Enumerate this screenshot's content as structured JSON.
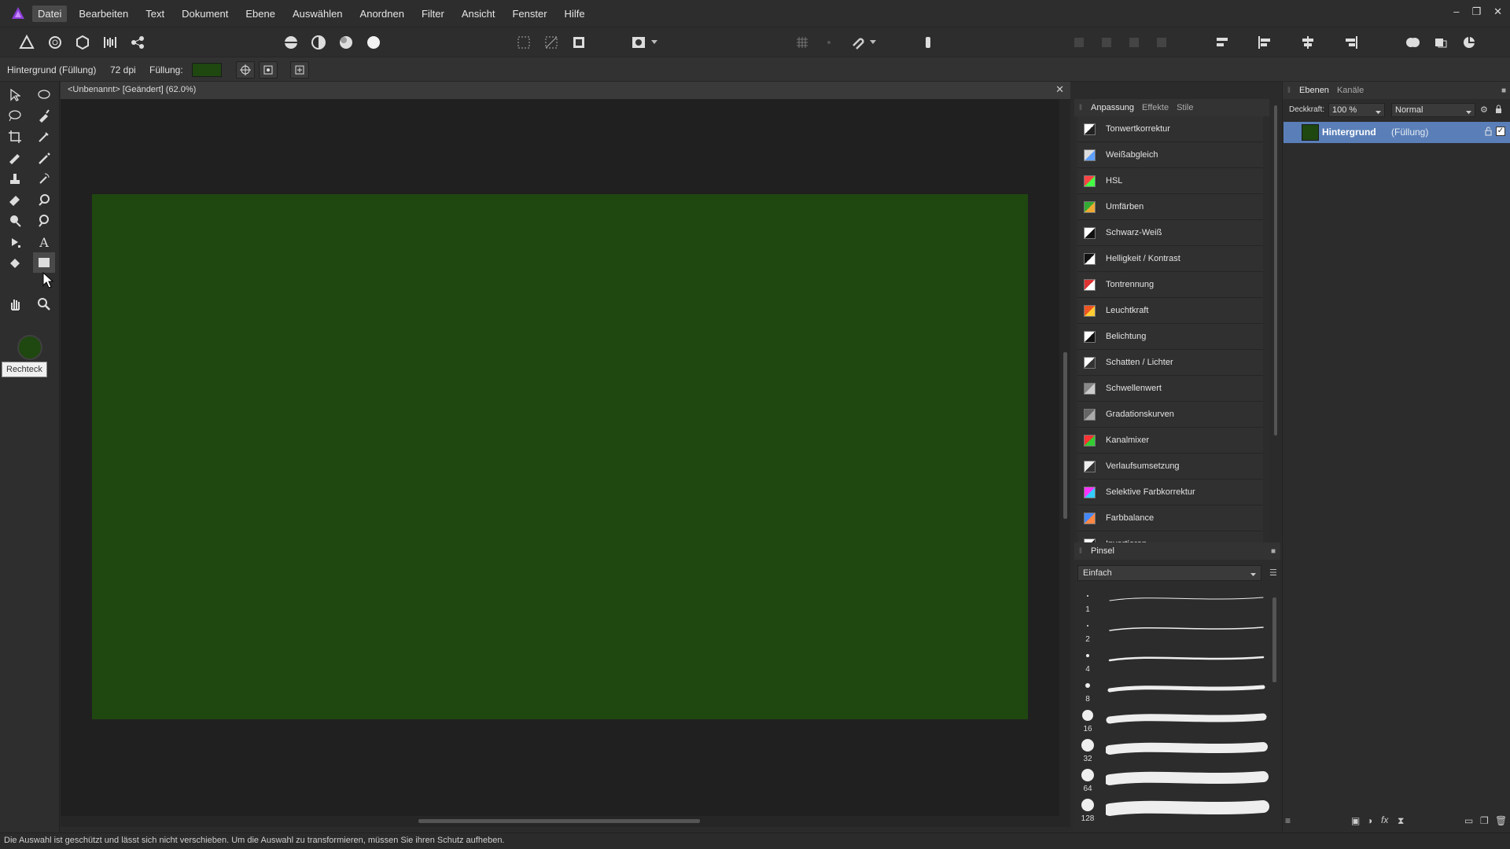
{
  "menubar": {
    "items": [
      "Datei",
      "Bearbeiten",
      "Text",
      "Dokument",
      "Ebene",
      "Auswählen",
      "Anordnen",
      "Filter",
      "Ansicht",
      "Fenster",
      "Hilfe"
    ],
    "active": "Datei"
  },
  "contextbar": {
    "layer_name": "Hintergrund (Füllung)",
    "dpi": "72 dpi",
    "fill_label": "Füllung:",
    "fill_color": "#1f4710"
  },
  "tools": {
    "tooltip": "Rechteck"
  },
  "document": {
    "tab_title": "<Unbenannt> [Geändert] (62.0%)",
    "artboard_color": "#1f4710"
  },
  "adjustment_panel": {
    "tabs": [
      "Anpassung",
      "Effekte",
      "Stile"
    ],
    "items": [
      {
        "label": "Tonwertkorrektur",
        "icon": "levels-icon"
      },
      {
        "label": "Weißabgleich",
        "icon": "white-balance-icon"
      },
      {
        "label": "HSL",
        "icon": "hsl-icon"
      },
      {
        "label": "Umfärben",
        "icon": "recolor-icon"
      },
      {
        "label": "Schwarz-Weiß",
        "icon": "black-white-icon"
      },
      {
        "label": "Helligkeit / Kontrast",
        "icon": "brightness-contrast-icon"
      },
      {
        "label": "Tontrennung",
        "icon": "posterize-icon"
      },
      {
        "label": "Leuchtkraft",
        "icon": "vibrance-icon"
      },
      {
        "label": "Belichtung",
        "icon": "exposure-icon"
      },
      {
        "label": "Schatten / Lichter",
        "icon": "shadows-highlights-icon"
      },
      {
        "label": "Schwellenwert",
        "icon": "threshold-icon"
      },
      {
        "label": "Gradationskurven",
        "icon": "curves-icon"
      },
      {
        "label": "Kanalmixer",
        "icon": "channel-mixer-icon"
      },
      {
        "label": "Verlaufsumsetzung",
        "icon": "gradient-map-icon"
      },
      {
        "label": "Selektive Farbkorrektur",
        "icon": "selective-color-icon"
      },
      {
        "label": "Farbbalance",
        "icon": "color-balance-icon"
      },
      {
        "label": "Invertieren",
        "icon": "invert-icon"
      }
    ]
  },
  "brush_panel": {
    "title": "Pinsel",
    "category": "Einfach",
    "sizes": [
      "1",
      "2",
      "4",
      "8",
      "16",
      "32",
      "64",
      "128"
    ]
  },
  "layers_panel": {
    "tabs": [
      "Ebenen",
      "Kanäle"
    ],
    "opacity_label": "Deckkraft:",
    "opacity_value": "100 %",
    "blend_mode": "Normal",
    "layer_name": "Hintergrund",
    "layer_type": "(Füllung)"
  },
  "status": {
    "text": "Die Auswahl ist geschützt und lässt sich nicht verschieben. Um die Auswahl zu transformieren, müssen Sie ihren Schutz aufheben."
  },
  "colors": {
    "accent_selection": "#5a7fb8",
    "fill_green": "#1f4710",
    "app_logo": "#8b3fd6"
  }
}
